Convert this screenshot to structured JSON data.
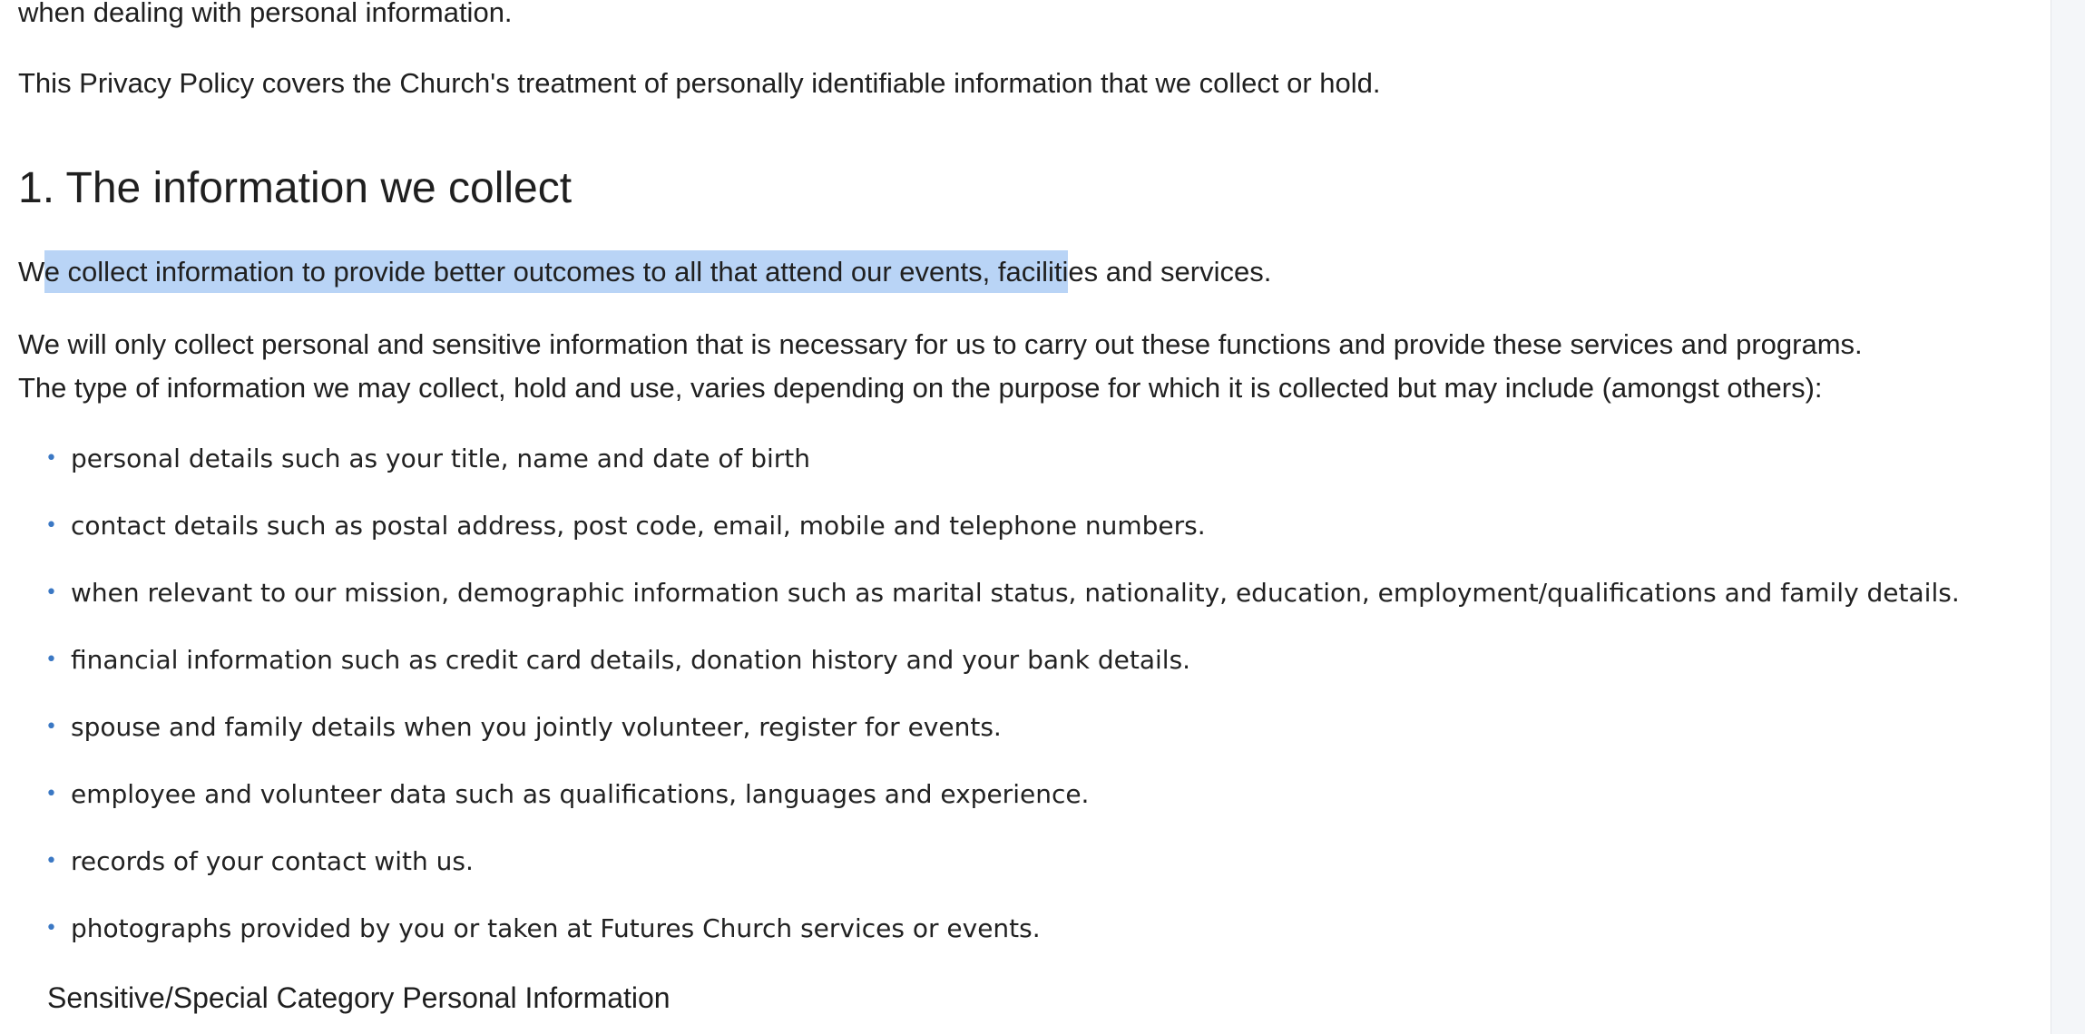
{
  "paragraphs": {
    "top_fragment": "when dealing with personal information.",
    "intro": "This Privacy Policy covers the Church's treatment of personally identifiable information that we collect or hold.",
    "collect_pre": "W",
    "collect_selected": "e collect information to provide better outcomes to all that attend our events, faciliti",
    "collect_post": "es and services.",
    "only_line1": "We will only collect personal and sensitive information that is necessary for us to carry out these functions and provide these services and programs.",
    "only_line2": "The type of information we may collect, hold and use, varies depending on the purpose for which it is collected but may include (amongst others):"
  },
  "heading": "1. The information we collect",
  "bullet_glyph": "•",
  "bullets": [
    "personal details such as your title, name and date of birth",
    "contact details such as postal address, post code, email, mobile and telephone numbers.",
    "when relevant to our mission, demographic information such as marital status, nationality, education, employment/qualifications and family details.",
    "financial information such as credit card details, donation history and your bank details.",
    "spouse and family details when you jointly volunteer, register for events.",
    "employee and volunteer data such as qualifications, languages and experience.",
    "records of your contact with us.",
    "photographs provided by you or taken at Futures Church services or events."
  ],
  "subheading": "Sensitive/Special Category Personal Information",
  "colors": {
    "selection": "#b9d4f6",
    "bullet": "#3b78c4",
    "text": "#202020"
  }
}
